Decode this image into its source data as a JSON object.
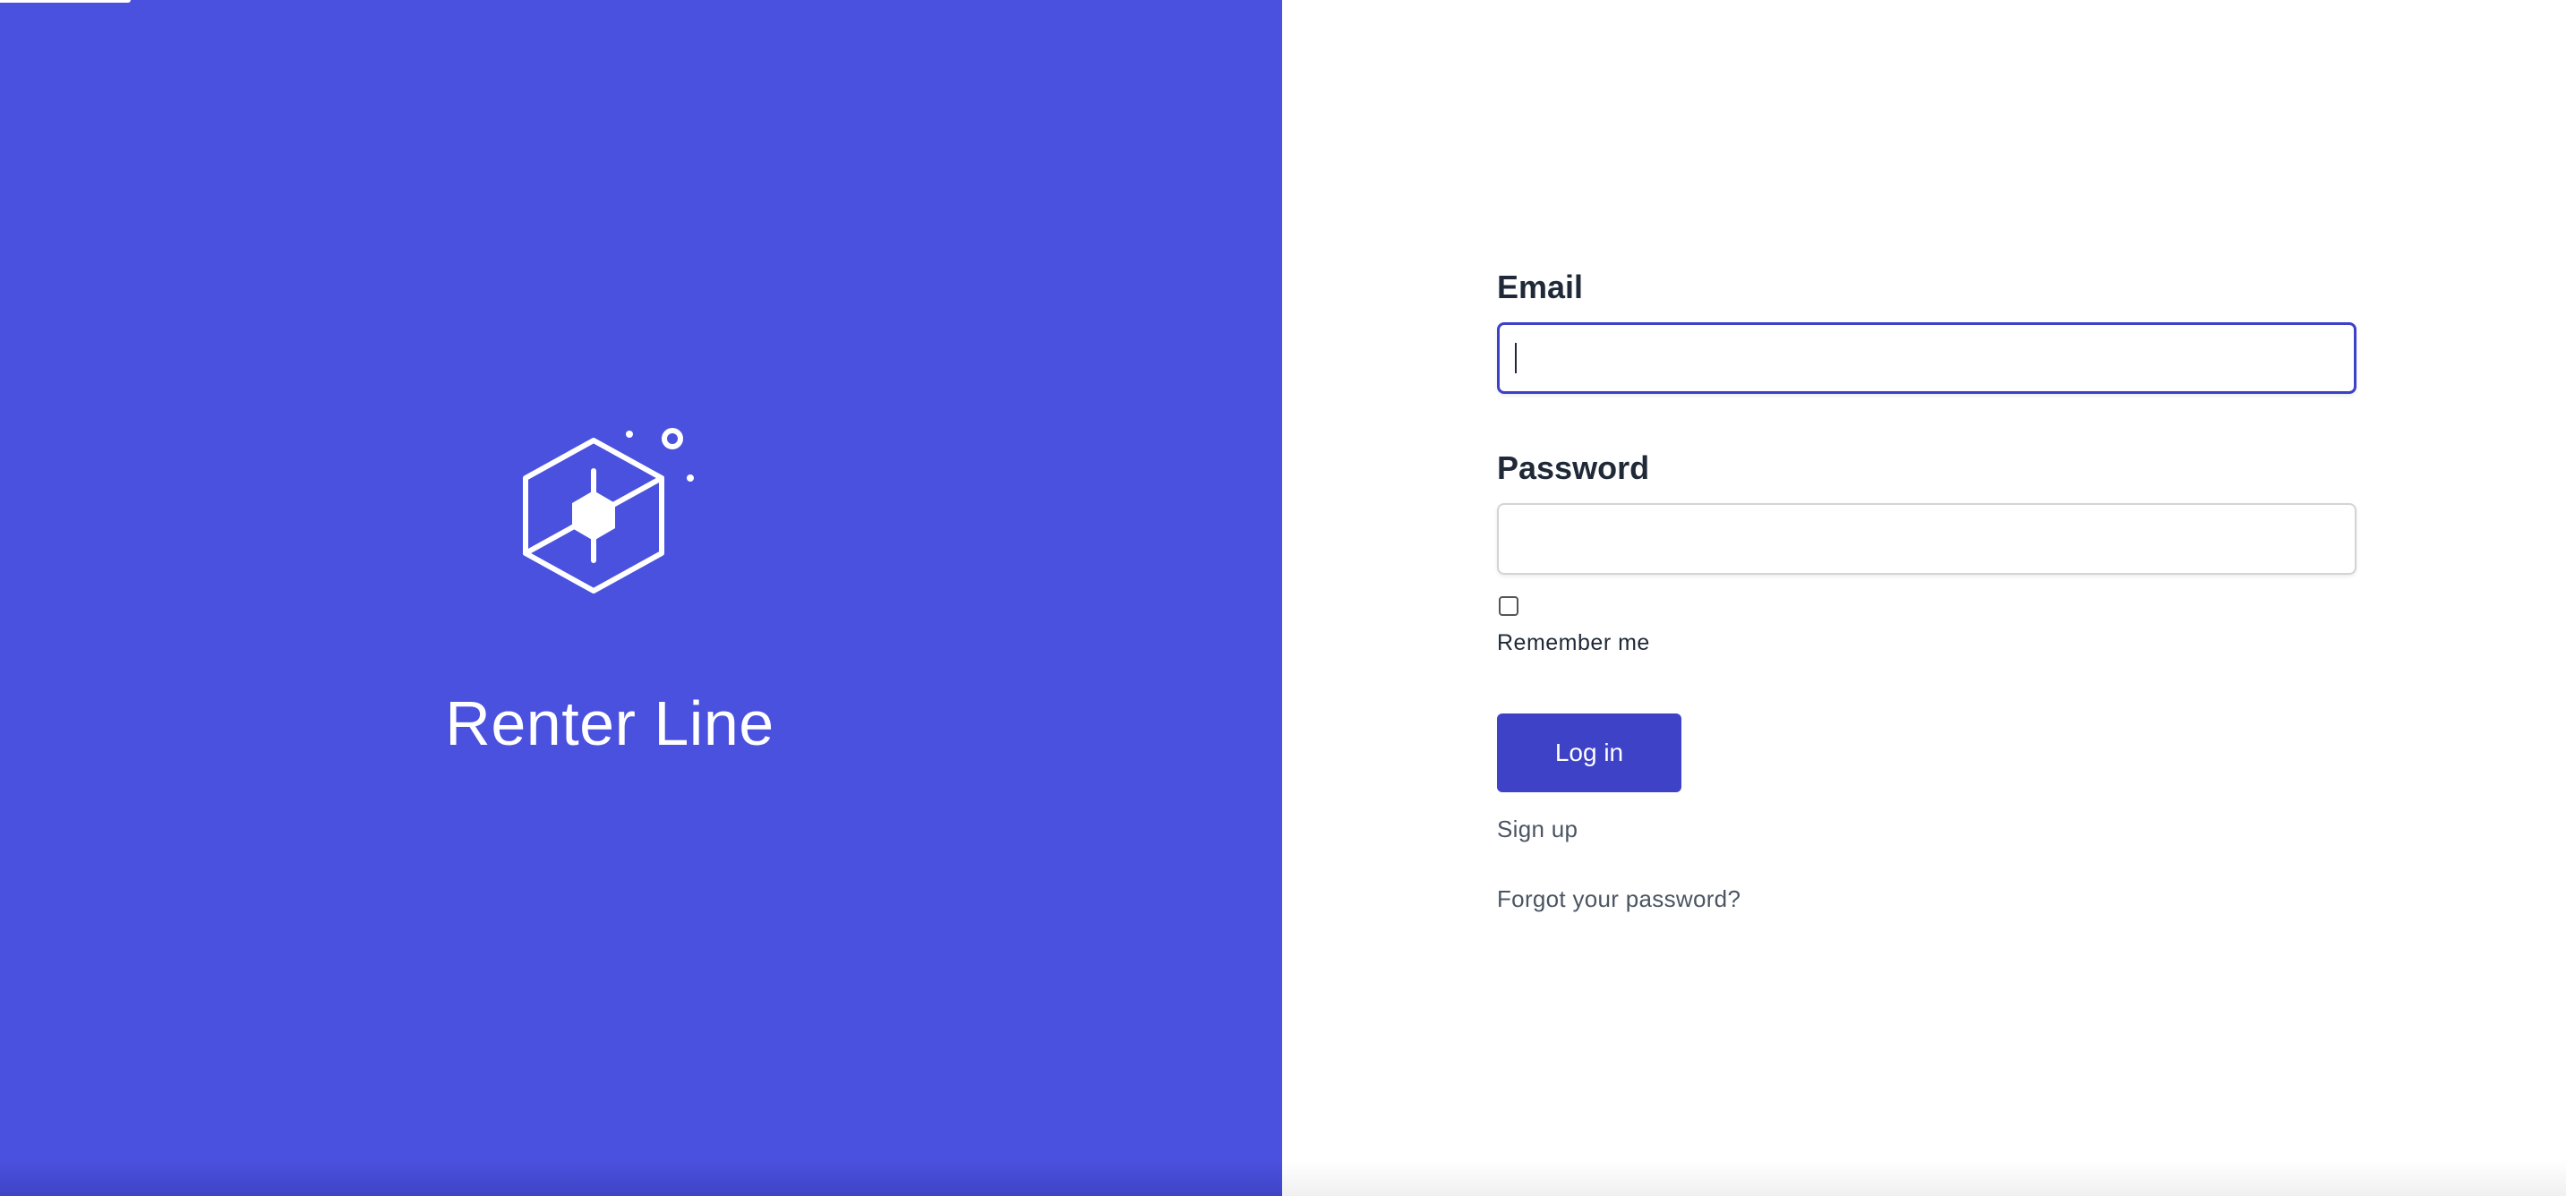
{
  "brand": {
    "name": "Renter Line",
    "logo_icon": "hexagon-cube-logo-icon",
    "background_color": "#4b51df"
  },
  "form": {
    "email": {
      "label": "Email",
      "value": "",
      "placeholder": ""
    },
    "password": {
      "label": "Password",
      "value": "",
      "placeholder": ""
    },
    "remember_me": {
      "label": "Remember me",
      "checked": false
    },
    "submit_label": "Log in",
    "signup_label": "Sign up",
    "forgot_label": "Forgot your password?"
  },
  "colors": {
    "accent": "#3e42c6",
    "focus_border": "#3c41c7",
    "text": "#1f2937",
    "link": "#4b5563"
  }
}
